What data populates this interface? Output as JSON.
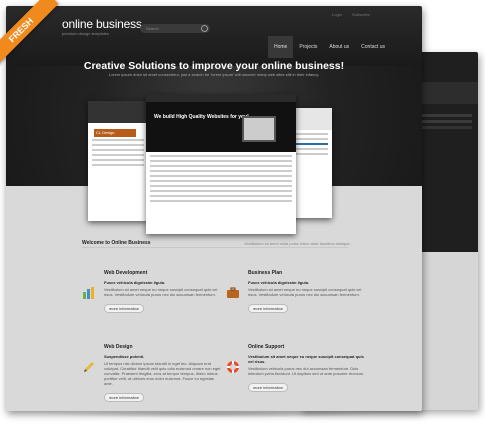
{
  "ribbon": "FRESH",
  "header": {
    "logo": "online business",
    "tagline": "premium design templates",
    "search_placeholder": "Search",
    "top_links": [
      "Login",
      "Subscribe"
    ],
    "nav": [
      "Home",
      "Projects",
      "About us",
      "Contact us"
    ]
  },
  "hero": {
    "title": "Creative Solutions to improve your online business!",
    "subtitle": "Lorem ipsum dolor sit amet consectetur, just a search for 'lorem ipsum' will uncover many web sites still in their infancy.",
    "main_shot_text": "We build High Quality Websites for you!",
    "left_shot_text": "CL Design"
  },
  "welcome": {
    "title": "Welcome to Online Business",
    "right": "Vestibulum sit amet nulla porta lorem ante faucibus tristique."
  },
  "services": [
    {
      "title": "Web Development",
      "heading": "Fusce vehicula dignissim ligula.",
      "body": "Vestibulum sit amet neque eu neque suscipit consequat quis vel risus. Vestibulum vehicula purus nec dui accumsan fermentum.",
      "button": "more information"
    },
    {
      "title": "Business Plan",
      "heading": "Fusce vehicula dignissim ligula.",
      "body": "Vestibulum sit amet neque eu neque suscipit consequat quis vel risus. Vestibulum vehicula purus nec dui accumsan fermentum.",
      "button": "more information"
    },
    {
      "title": "Web Design",
      "heading": "Suspendisse potenti.",
      "body": "Ut tempus nisi dictum ipsum blandit in eget leo. Aliquam erat volutpat. Curabitur blandit velit quis odio euismod ornare non eget convallis. Praesent fringilla, eros at tempor tempus, libero metus porttitor velit, at ultrices eros dolor euismod. Fusce eu egestas ante.",
      "button": "more information"
    },
    {
      "title": "Online Support",
      "heading": "Vestibulum sit amet neque eu neque suscipit consequat quis vel risus.",
      "body": "Vestibulum vehicula purus nec dui accumsan fermentum. Duis interdum porta tincidunt. Ut dapibus sed ut ante posuere rhoncus.",
      "button": "more information"
    }
  ],
  "colors": {
    "accent": "#f08a1c",
    "dark": "#1a1a1a"
  }
}
